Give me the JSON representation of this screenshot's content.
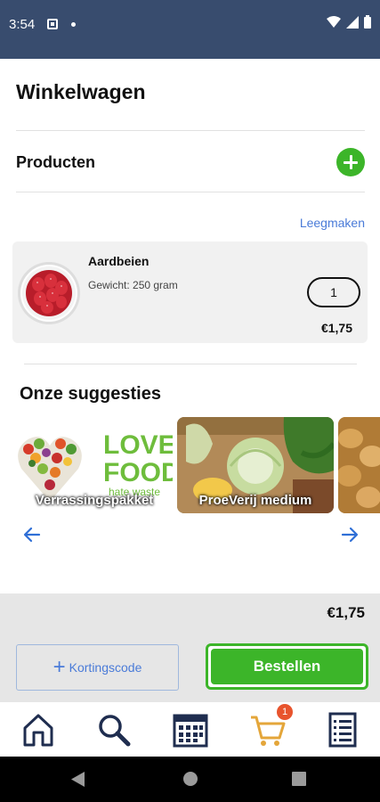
{
  "status_bar": {
    "time": "3:54"
  },
  "header": {
    "title": "Winkelwagen"
  },
  "products_section": {
    "label": "Producten",
    "clear_label": "Leegmaken"
  },
  "cart_items": [
    {
      "name": "Aardbeien",
      "weight": "Gewicht: 250 gram",
      "quantity": "1",
      "price": "€1,75"
    }
  ],
  "suggestions": {
    "title": "Onze suggesties",
    "items": [
      {
        "caption": "Verrassingspakket",
        "logo_line1": "LOVE",
        "logo_line2": "FOOD",
        "logo_line3": "hate waste"
      },
      {
        "caption": "ProeVerij medium"
      },
      {
        "caption": ""
      }
    ]
  },
  "summary": {
    "total": "€1,75"
  },
  "actions": {
    "discount_label": "Kortingscode",
    "order_label": "Bestellen"
  },
  "tabbar": {
    "tabs": [
      "home-icon",
      "search-icon",
      "calendar-icon",
      "cart-icon",
      "list-icon"
    ],
    "cart_badge": "1"
  },
  "colors": {
    "header": "#384c6e",
    "accent_green": "#3cb529",
    "link_blue": "#4a7bd8",
    "badge": "#e8542d",
    "cart_icon": "#e4a63a",
    "nav_icon": "#1f2d4f"
  }
}
